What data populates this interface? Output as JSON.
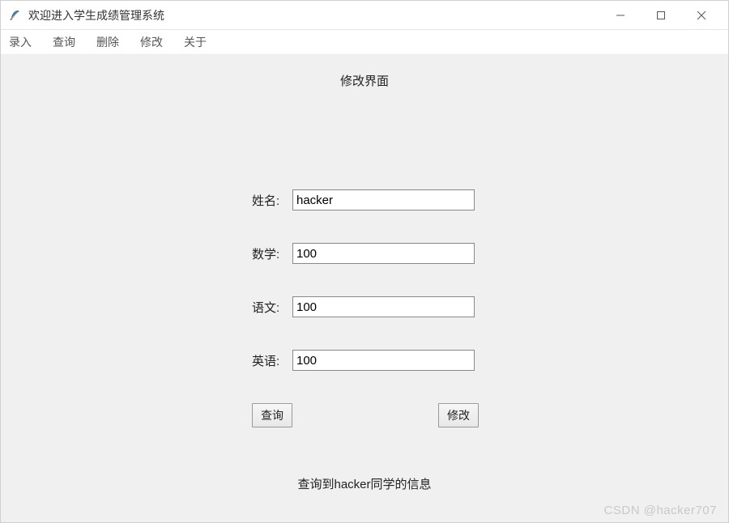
{
  "titlebar": {
    "icon_name": "feather-icon",
    "title": "欢迎进入学生成绩管理系统"
  },
  "menubar": {
    "items": [
      "录入",
      "查询",
      "删除",
      "修改",
      "关于"
    ]
  },
  "page": {
    "title": "修改界面"
  },
  "form": {
    "fields": [
      {
        "label": "姓名:",
        "value": "hacker"
      },
      {
        "label": "数学:",
        "value": "100"
      },
      {
        "label": "语文:",
        "value": "100"
      },
      {
        "label": "英语:",
        "value": "100"
      }
    ],
    "buttons": {
      "query": "查询",
      "modify": "修改"
    }
  },
  "status": {
    "message": "查询到hacker同学的信息"
  },
  "watermark": "CSDN @hacker707"
}
